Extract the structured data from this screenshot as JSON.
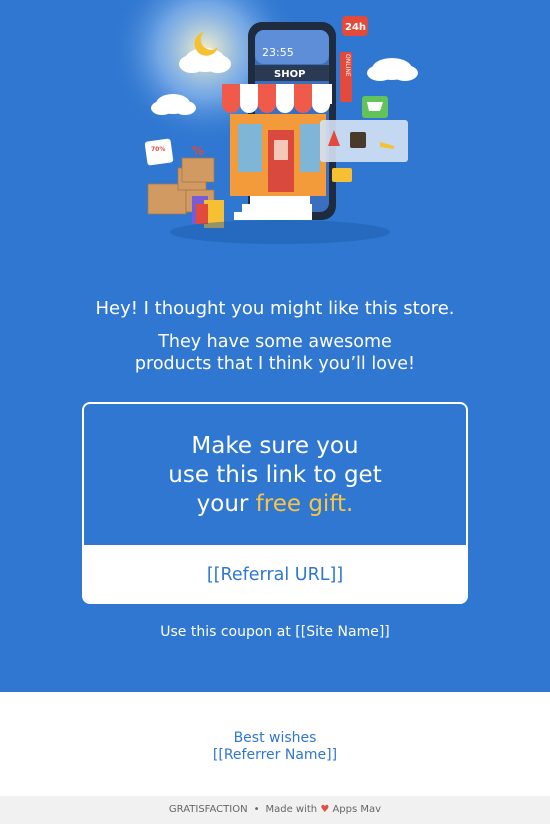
{
  "hero": {
    "background_color": "#2f77d1",
    "illustration": {
      "name": "online-shop-illustration",
      "shop_sign": "SHOP",
      "clock": "23:55",
      "badge_24h": "24h",
      "online_sign": "ONLINE",
      "discount": "70%",
      "percent": "%"
    },
    "intro_line": "Hey! I thought you might like this store.",
    "message_lines": [
      "They have some awesome",
      "products that I think you’ll love!"
    ]
  },
  "card": {
    "headline_lines": [
      "Make sure you",
      "use this link to get"
    ],
    "headline_prefix": "your ",
    "headline_highlight": "free gift.",
    "highlight_color": "#f7c548",
    "referral_link": "[[Referral URL]]"
  },
  "coupon_note": "Use this coupon at [[Site Name]]",
  "signoff": {
    "greeting": "Best wishes",
    "referrer": "[[Referrer Name]]"
  },
  "footer": {
    "brand": "GRATISFACTION",
    "separator": "•",
    "made_with": "Made with",
    "heart": "♥",
    "maker": "Apps Mav"
  }
}
